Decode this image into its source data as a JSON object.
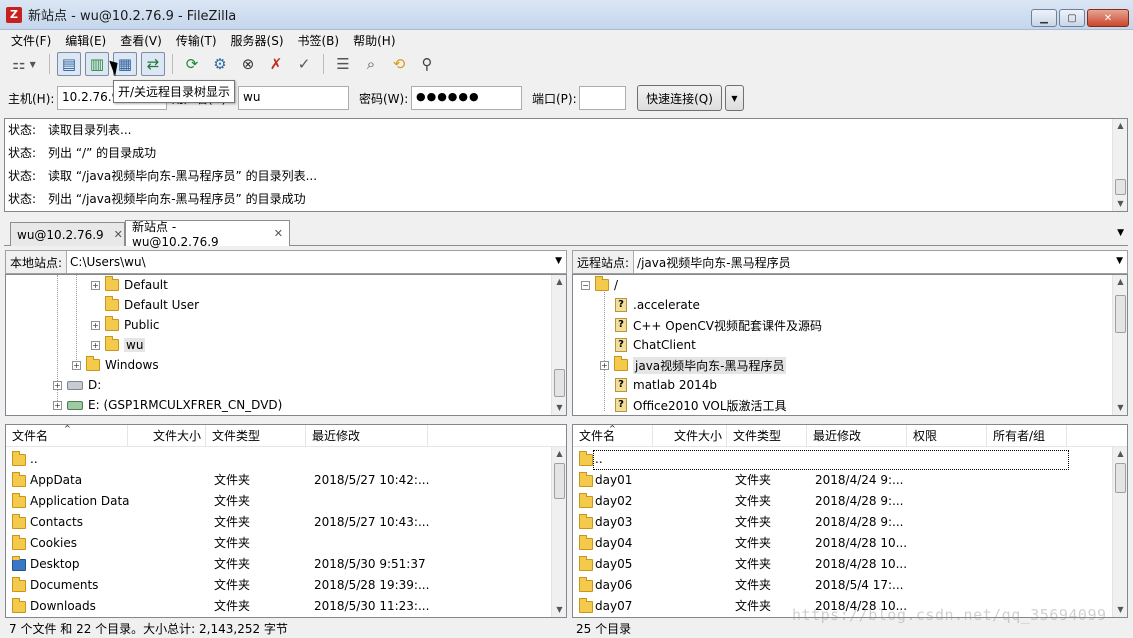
{
  "window": {
    "title": "新站点 - wu@10.2.76.9 - FileZilla",
    "app_icon": "Z"
  },
  "menu": [
    "文件(F)",
    "编辑(E)",
    "查看(V)",
    "传输(T)",
    "服务器(S)",
    "书签(B)",
    "帮助(H)"
  ],
  "toolbar": {
    "tooltip": "开/关远程目录树显示",
    "buttons": [
      "site-manager-icon",
      "toggle-log-icon",
      "toggle-local-tree-icon",
      "toggle-remote-tree-icon",
      "toggle-queue-icon",
      "refresh-icon",
      "process-queue-icon",
      "cancel-icon",
      "disconnect-icon",
      "reconnect-icon",
      "filter-icon",
      "compare-icon",
      "sync-browse-icon",
      "search-icon"
    ]
  },
  "quickconnect": {
    "host_label": "主机(H):",
    "host_value": "10.2.76.9",
    "user_label": "用户名(U):",
    "user_value": "wu",
    "password_label": "密码(W):",
    "password_value": "●●●●●●",
    "port_label": "端口(P):",
    "port_value": "",
    "connect_label": "快速连接(Q)",
    "dropdown": "▼"
  },
  "log": [
    {
      "label": "状态:",
      "text": "读取目录列表..."
    },
    {
      "label": "状态:",
      "text": "列出 “/” 的目录成功"
    },
    {
      "label": "状态:",
      "text": "读取 “/java视频毕向东-黑马程序员” 的目录列表..."
    },
    {
      "label": "状态:",
      "text": "列出 “/java视频毕向东-黑马程序员” 的目录成功"
    }
  ],
  "tabs": [
    {
      "label": "wu@10.2.76.9",
      "close": "✕"
    },
    {
      "label": "新站点 - wu@10.2.76.9",
      "close": "✕"
    }
  ],
  "local": {
    "site_label": "本地站点:",
    "path": "C:\\Users\\wu\\",
    "tree": [
      {
        "name": "Default",
        "type": "folder"
      },
      {
        "name": "Default User",
        "type": "folder"
      },
      {
        "name": "Public",
        "type": "folder"
      },
      {
        "name": "wu",
        "type": "user-folder"
      },
      {
        "name": "Windows",
        "type": "folder"
      },
      {
        "name": "D:",
        "type": "drive"
      },
      {
        "name": "E: (GSP1RMCULXFRER_CN_DVD)",
        "type": "dvd"
      }
    ],
    "columns": [
      "文件名",
      "文件大小",
      "文件类型",
      "最近修改"
    ],
    "files": [
      {
        "name": "..",
        "type": "",
        "modified": ""
      },
      {
        "name": "AppData",
        "type": "文件夹",
        "modified": "2018/5/27 10:42:..."
      },
      {
        "name": "Application Data",
        "type": "文件夹",
        "modified": ""
      },
      {
        "name": "Contacts",
        "type": "文件夹",
        "modified": "2018/5/27 10:43:..."
      },
      {
        "name": "Cookies",
        "type": "文件夹",
        "modified": ""
      },
      {
        "name": "Desktop",
        "type": "文件夹",
        "modified": "2018/5/30 9:51:37"
      },
      {
        "name": "Documents",
        "type": "文件夹",
        "modified": "2018/5/28 19:39:..."
      },
      {
        "name": "Downloads",
        "type": "文件夹",
        "modified": "2018/5/30 11:23:..."
      }
    ],
    "status": "7 个文件 和 22 个目录。大小总计: 2,143,252 字节"
  },
  "remote": {
    "site_label": "远程站点:",
    "path": "/java视频毕向东-黑马程序员",
    "tree": [
      {
        "name": "/",
        "type": "folder"
      },
      {
        "name": ".accelerate",
        "type": "unknown"
      },
      {
        "name": "C++ OpenCV视频配套课件及源码",
        "type": "unknown"
      },
      {
        "name": "ChatClient",
        "type": "unknown"
      },
      {
        "name": "java视频毕向东-黑马程序员",
        "type": "folder"
      },
      {
        "name": "matlab 2014b",
        "type": "unknown"
      },
      {
        "name": "Office2010 VOL版激活工具",
        "type": "unknown"
      }
    ],
    "columns": [
      "文件名",
      "文件大小",
      "文件类型",
      "最近修改",
      "权限",
      "所有者/组"
    ],
    "files": [
      {
        "name": "..",
        "type": "",
        "modified": ""
      },
      {
        "name": "day01",
        "type": "文件夹",
        "modified": "2018/4/24 9:..."
      },
      {
        "name": "day02",
        "type": "文件夹",
        "modified": "2018/4/28 9:..."
      },
      {
        "name": "day03",
        "type": "文件夹",
        "modified": "2018/4/28 9:..."
      },
      {
        "name": "day04",
        "type": "文件夹",
        "modified": "2018/4/28 10..."
      },
      {
        "name": "day05",
        "type": "文件夹",
        "modified": "2018/4/28 10..."
      },
      {
        "name": "day06",
        "type": "文件夹",
        "modified": "2018/5/4 17:..."
      },
      {
        "name": "day07",
        "type": "文件夹",
        "modified": "2018/4/28 10..."
      }
    ],
    "status": "25 个目录"
  },
  "watermark": "https://blog.csdn.net/qq_35694099"
}
